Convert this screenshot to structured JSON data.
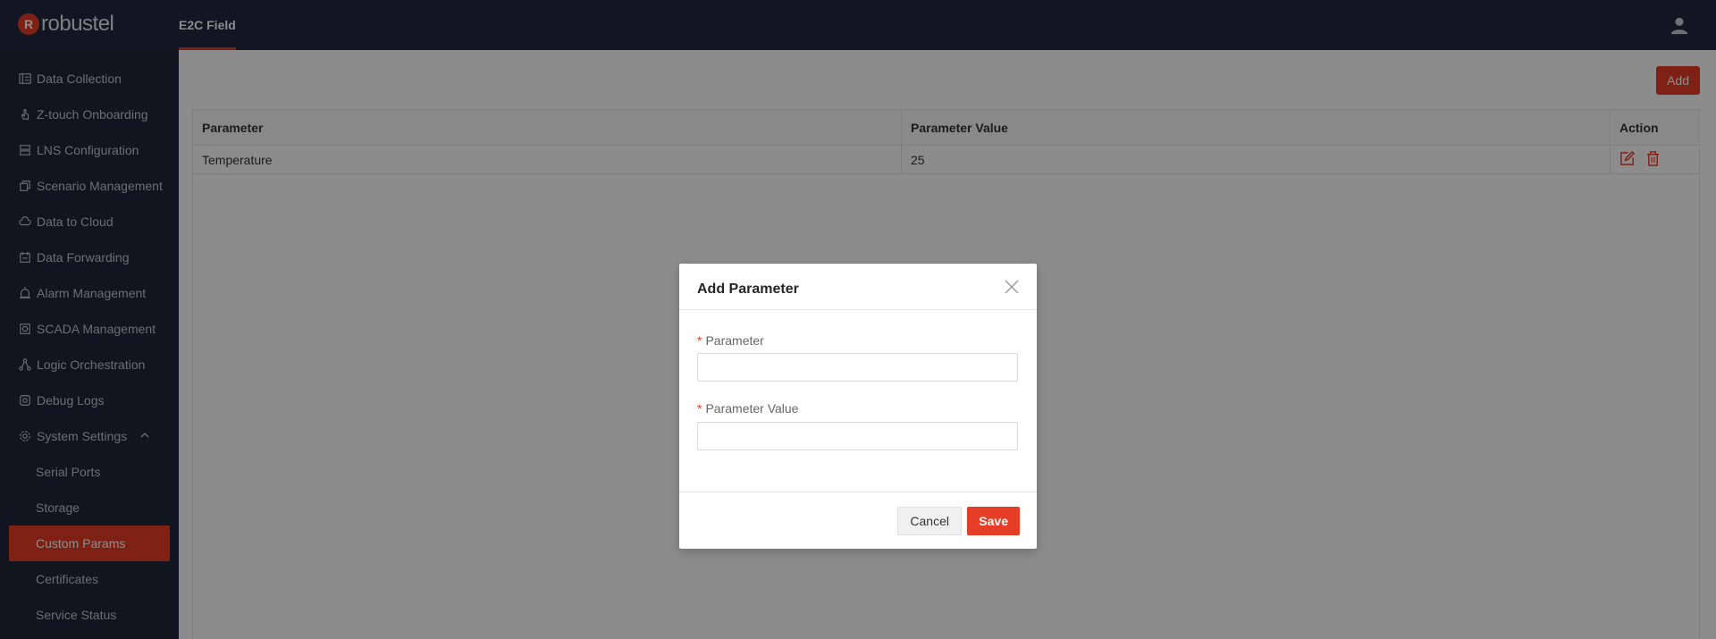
{
  "brand": {
    "logo_mark": "R",
    "logo_text": "robustel"
  },
  "header": {
    "active_tab": "E2C Field"
  },
  "sidebar": {
    "items": [
      {
        "label": "Data Collection",
        "icon": "data-collection-icon"
      },
      {
        "label": "Z-touch Onboarding",
        "icon": "hand-pointer-icon"
      },
      {
        "label": "LNS Configuration",
        "icon": "server-icon"
      },
      {
        "label": "Scenario Management",
        "icon": "copy-icon"
      },
      {
        "label": "Data to Cloud",
        "icon": "cloud-icon"
      },
      {
        "label": "Data Forwarding",
        "icon": "calendar-icon"
      },
      {
        "label": "Alarm Management",
        "icon": "alarm-icon"
      },
      {
        "label": "SCADA Management",
        "icon": "scada-icon"
      },
      {
        "label": "Logic Orchestration",
        "icon": "flow-icon"
      },
      {
        "label": "Debug Logs",
        "icon": "debug-icon"
      },
      {
        "label": "System Settings",
        "icon": "gear-icon"
      }
    ],
    "sub_items": [
      {
        "label": "Serial Ports"
      },
      {
        "label": "Storage"
      },
      {
        "label": "Custom Params"
      },
      {
        "label": "Certificates"
      },
      {
        "label": "Service Status"
      }
    ]
  },
  "toolbar": {
    "add_label": "Add"
  },
  "table": {
    "columns": [
      "Parameter",
      "Parameter Value",
      "Action"
    ],
    "rows": [
      {
        "parameter": "Temperature",
        "value": "25"
      }
    ]
  },
  "modal": {
    "title": "Add Parameter",
    "fields": [
      {
        "label": "Parameter",
        "required": true,
        "value": ""
      },
      {
        "label": "Parameter Value",
        "required": true,
        "value": ""
      }
    ],
    "cancel_label": "Cancel",
    "save_label": "Save"
  },
  "colors": {
    "accent": "#e53d26",
    "sidebar_bg": "#1f2739",
    "topbar_bg": "#212940"
  }
}
